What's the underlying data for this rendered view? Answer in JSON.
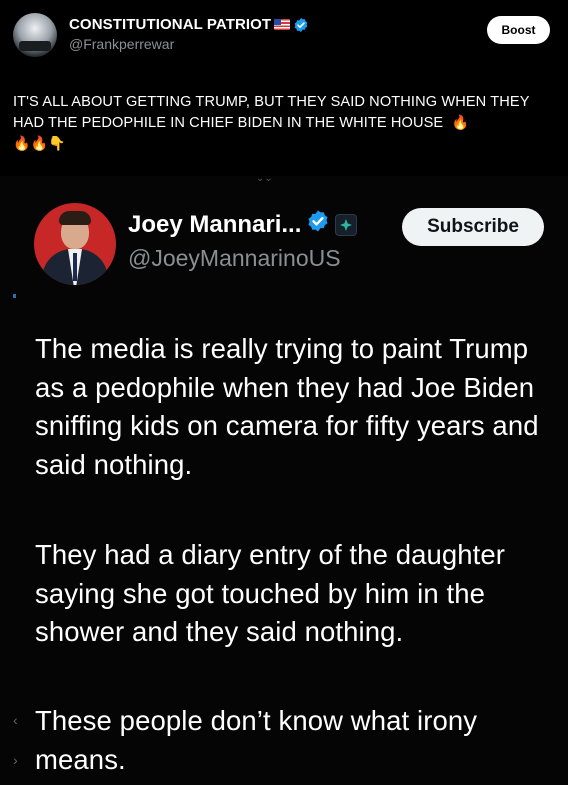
{
  "post": {
    "author": {
      "name": "CONSTITUTIONAL PATRIOT",
      "handle": "@Frankperrewar"
    },
    "boost_label": "Boost",
    "text": "IT'S ALL ABOUT GETTING TRUMP, BUT THEY SAID NOTHING WHEN THEY HAD THE PEDOPHILE IN CHIEF BIDEN IN THE WHITE HOUSE",
    "emojis_inline": "🔥",
    "emojis_line2": "🔥🔥👇"
  },
  "embed": {
    "author": {
      "name": "Joey Mannari...",
      "handle": "@JoeyMannarinoUS"
    },
    "subscribe_label": "Subscribe",
    "paragraphs": [
      "The media is really trying to paint Trump as a pedophile when they had Joe Biden sniffing kids on camera for fifty years and said nothing.",
      "They had a diary entry of the daughter saying she got touched by him in the shower and they said nothing.",
      "These people don’t know what irony means."
    ]
  },
  "colors": {
    "background": "#000000",
    "secondary_text": "#8b8f94",
    "verified_blue": "#1d9bf0",
    "avatar_red": "#c82727"
  },
  "icons": [
    "flag-icon",
    "verified-icon",
    "gov-badge-icon"
  ]
}
